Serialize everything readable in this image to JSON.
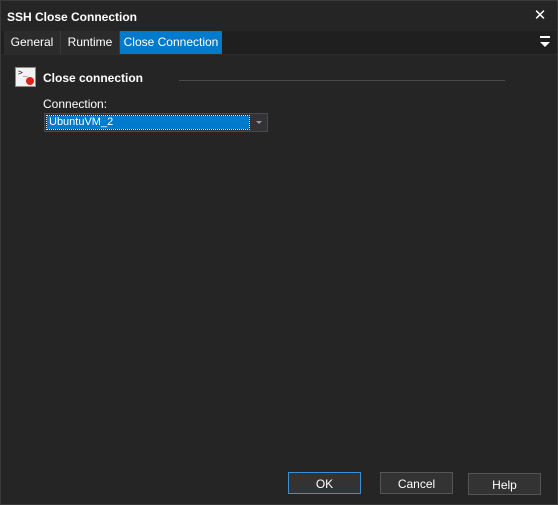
{
  "window": {
    "title": "SSH Close Connection",
    "close_glyph": "✕"
  },
  "tabs": [
    {
      "label": "General"
    },
    {
      "label": "Runtime"
    },
    {
      "label": "Close Connection",
      "active": true
    }
  ],
  "section": {
    "title": "Close connection",
    "icon": "terminal-close-icon"
  },
  "connection": {
    "label": "Connection:",
    "selected": "UbuntuVM_2"
  },
  "buttons": {
    "ok": "OK",
    "cancel": "Cancel",
    "help": "Help"
  },
  "colors": {
    "accent": "#007acc",
    "background": "#252526",
    "close_dot": "#e0201b"
  }
}
